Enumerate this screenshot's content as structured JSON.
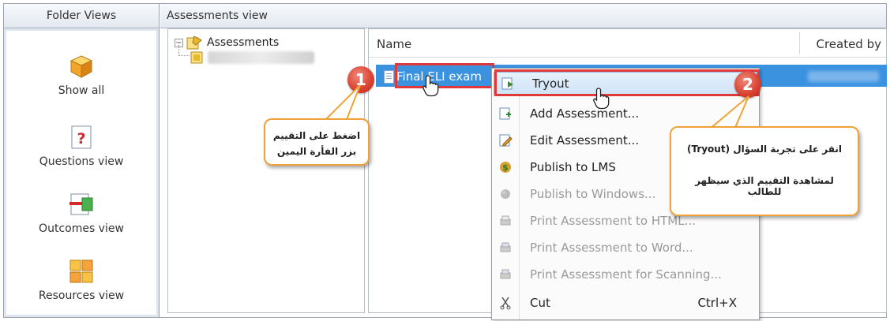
{
  "folder_views": {
    "header": "Folder Views",
    "items": [
      {
        "label": "Show all",
        "icon": "cube-icon"
      },
      {
        "label": "Questions view",
        "icon": "question-icon"
      },
      {
        "label": "Outcomes view",
        "icon": "outcomes-icon"
      },
      {
        "label": "Resources view",
        "icon": "resources-icon"
      }
    ]
  },
  "assessments_view": {
    "header": "Assessments view",
    "tree_root": "Assessments",
    "toggle": "−"
  },
  "list": {
    "columns": {
      "name": "Name",
      "created_by": "Created by"
    },
    "selected_row": "Final ELI exam"
  },
  "context_menu": {
    "items": [
      {
        "label": "Tryout",
        "shortcut": "",
        "disabled": false,
        "hover": true,
        "icon": "tryout-icon"
      },
      {
        "label": "Add Assessment...",
        "shortcut": "",
        "disabled": false,
        "hover": false,
        "icon": "add-assessment-icon"
      },
      {
        "label": "Edit Assessment...",
        "shortcut": "",
        "disabled": false,
        "hover": false,
        "icon": "edit-assessment-icon"
      },
      {
        "label": "Publish to LMS",
        "shortcut": "",
        "disabled": false,
        "hover": false,
        "icon": "publish-lms-icon"
      },
      {
        "label": "Publish to Windows...",
        "shortcut": "",
        "disabled": true,
        "hover": false,
        "icon": "publish-windows-icon"
      },
      {
        "label": "Print Assessment to HTML...",
        "shortcut": "",
        "disabled": true,
        "hover": false,
        "icon": "print-icon"
      },
      {
        "label": "Print Assessment to Word...",
        "shortcut": "",
        "disabled": true,
        "hover": false,
        "icon": "print-word-icon"
      },
      {
        "label": "Print Assessment for Scanning...",
        "shortcut": "",
        "disabled": true,
        "hover": false,
        "icon": "print-scan-icon"
      },
      {
        "label": "Cut",
        "shortcut": "Ctrl+X",
        "disabled": false,
        "hover": false,
        "icon": "cut-icon"
      }
    ]
  },
  "annotations": {
    "step1": "1",
    "step2": "2",
    "callout1": "اضغط على التقييم بزر الفأرة اليمين",
    "callout2_line1": "انقر على تجربة السؤال (Tryout)",
    "callout2_line2": "لمشاهدة التقييم الذي سيظهر للطالب"
  },
  "colors": {
    "highlight": "#e0393c",
    "selection": "#3b93e0",
    "callout_border": "#f0a23a"
  }
}
